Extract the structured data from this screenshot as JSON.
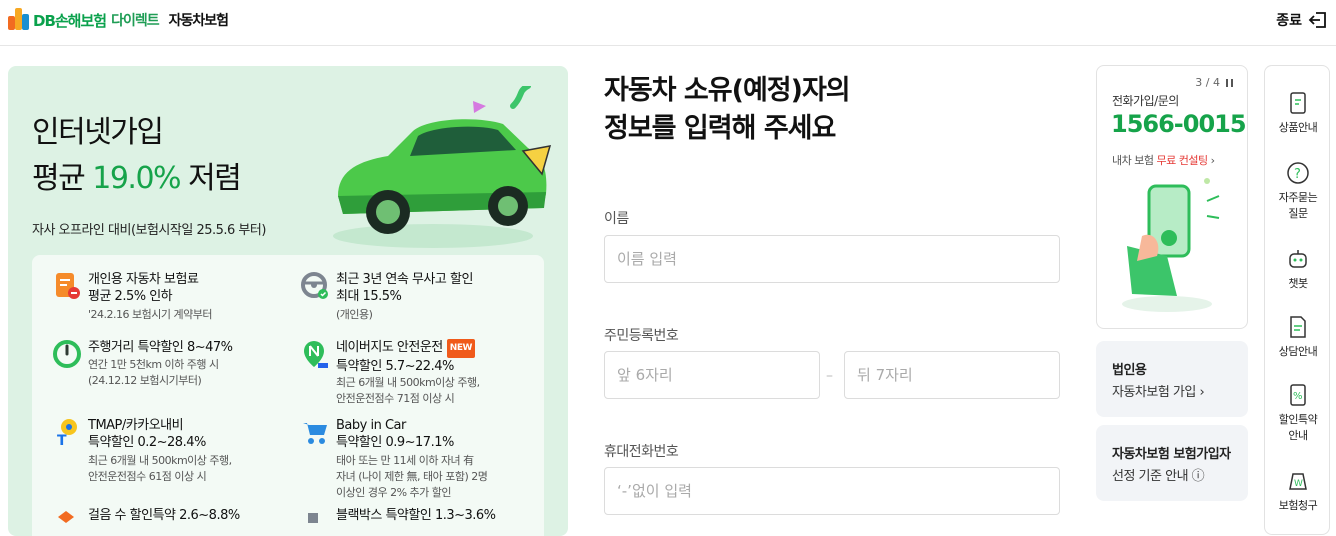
{
  "header": {
    "brand": "DB손해보험",
    "brand_direct": "다이렉트",
    "product": "자동차보험",
    "exit_label": "종료"
  },
  "promo": {
    "title_line1": "인터넷가입",
    "title_prefix": "평균",
    "title_pct": "19.0%",
    "title_suffix": "저렴",
    "subtitle": "자사 오프라인 대비(보험시작일 25.5.6 부터)",
    "benefits": [
      {
        "title": "개인용 자동차 보험료\n평균 2.5% 인하",
        "desc": "'24.2.16 보험시기 계약부터",
        "icon": "document-discount-icon"
      },
      {
        "title": "최근 3년 연속 무사고 할인\n최대 15.5%",
        "desc": "(개인용)",
        "icon": "steering-wheel-icon"
      },
      {
        "title": "주행거리 특약할인 8~47%",
        "desc": "연간 1만 5천km 이하 주행 시\n(24.12.12 보험시기부터)",
        "icon": "gauge-icon"
      },
      {
        "title": "네이버지도 안전운전",
        "badge": "NEW",
        "title2": "특약할인 5.7~22.4%",
        "desc": "최근 6개월 내 500km이상 주행,\n안전운전점수 71점 이상 시",
        "icon": "naver-map-icon"
      },
      {
        "title": "TMAP/카카오내비\n특약할인 0.2~28.4%",
        "desc": "최근 6개월 내 500km이상 주행,\n안전운전점수 61점 이상 시",
        "icon": "navigation-icon"
      },
      {
        "title": "Baby in Car\n특약할인 0.9~17.1%",
        "desc": "태아 또는 만 11세 이하 자녀 有\n자녀 (나이 제한 無, 태아 포함) 2명\n이상인 경우 2% 추가 할인",
        "icon": "stroller-icon"
      },
      {
        "title": "걸음 수 할인특약 2.6~8.8%",
        "desc": "",
        "icon": "walking-icon"
      },
      {
        "title": "블랙박스 특약할인 1.3~3.6%",
        "desc": "",
        "icon": "dashcam-icon"
      }
    ]
  },
  "form": {
    "title_line1": "자동차 소유(예정)자의",
    "title_line2": "정보를 입력해 주세요",
    "name_label": "이름",
    "name_placeholder": "이름 입력",
    "rrn_label": "주민등록번호",
    "rrn_front_placeholder": "앞 6자리",
    "rrn_back_placeholder": "뒤 7자리",
    "rrn_separator": "–",
    "phone_label": "휴대전화번호",
    "phone_placeholder": "‘-’없이 입력"
  },
  "contact": {
    "pager": "3 / 4",
    "label": "전화가입/문의",
    "number": "1566-0015",
    "consult_prefix": "내차 보험",
    "consult_highlight": "무료 컨설팅",
    "consult_arrow": "›"
  },
  "corporate": {
    "heading": "법인용",
    "link": "자동차보험 가입 ›"
  },
  "criteria": {
    "heading": "자동차보험 보험가입자",
    "link": "선정 기준 안내 ⓘ"
  },
  "sidenav": {
    "items": [
      {
        "label": "상품안내",
        "icon": "product-guide-icon"
      },
      {
        "label": "자주묻는\n질문",
        "icon": "question-icon"
      },
      {
        "label": "챗봇",
        "icon": "chatbot-icon"
      },
      {
        "label": "상담안내",
        "icon": "consult-doc-icon"
      },
      {
        "label": "할인특약\n안내",
        "icon": "discount-icon"
      },
      {
        "label": "보험청구",
        "icon": "claim-icon"
      }
    ]
  },
  "colors": {
    "brand_green": "#16a34a",
    "promo_bg": "#ddf2e4",
    "accent_red": "#e53935",
    "badge_orange": "#f05a1a"
  }
}
